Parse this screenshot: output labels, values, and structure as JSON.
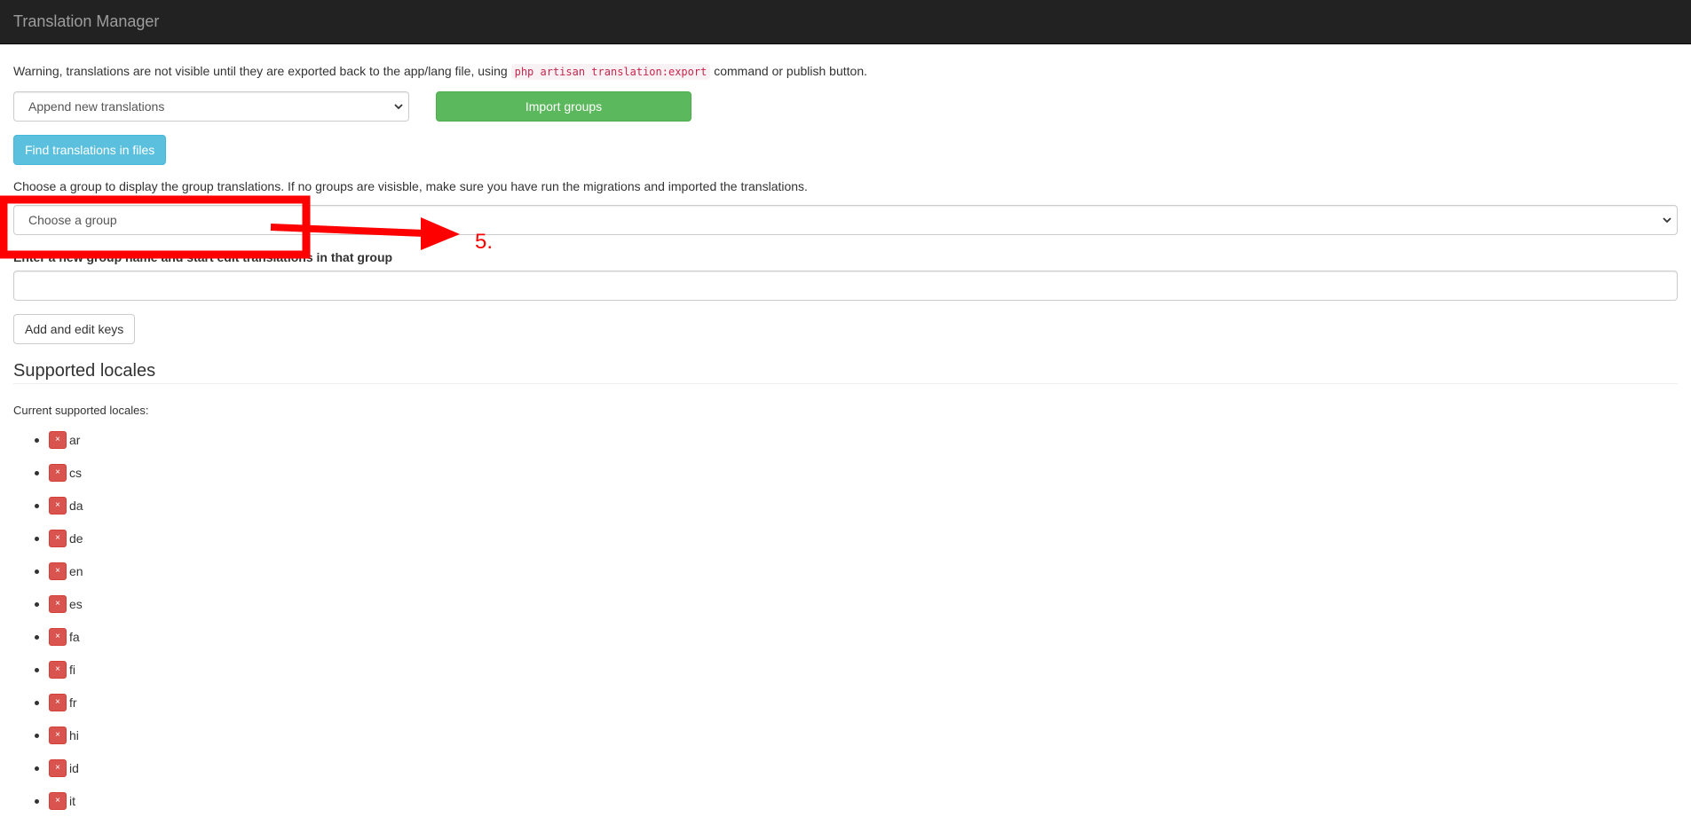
{
  "navbar": {
    "brand": "Translation Manager"
  },
  "warning": {
    "before": "Warning, translations are not visible until they are exported back to the app/lang file, using ",
    "code": "php artisan translation:export",
    "after": " command or publish button."
  },
  "import": {
    "mode_selected": "Append new translations",
    "import_button": "Import groups"
  },
  "find_button": "Find translations in files",
  "group_select": {
    "instructions": "Choose a group to display the group translations. If no groups are visisble, make sure you have run the migrations and imported the translations.",
    "selected": "Choose a group"
  },
  "new_group": {
    "label": "Enter a new group name and start edit translations in that group",
    "value": "",
    "submit_button": "Add and edit keys"
  },
  "locales": {
    "heading": "Supported locales",
    "current_label": "Current supported locales:",
    "remove_symbol": "×",
    "items": [
      "ar",
      "cs",
      "da",
      "de",
      "en",
      "es",
      "fa",
      "fi",
      "fr",
      "hi",
      "id",
      "it"
    ]
  },
  "annotation": {
    "step_label": "5.",
    "color": "#ff0000"
  },
  "icons": {
    "select_chevron": "chevron-down-icon",
    "remove": "close-icon"
  }
}
